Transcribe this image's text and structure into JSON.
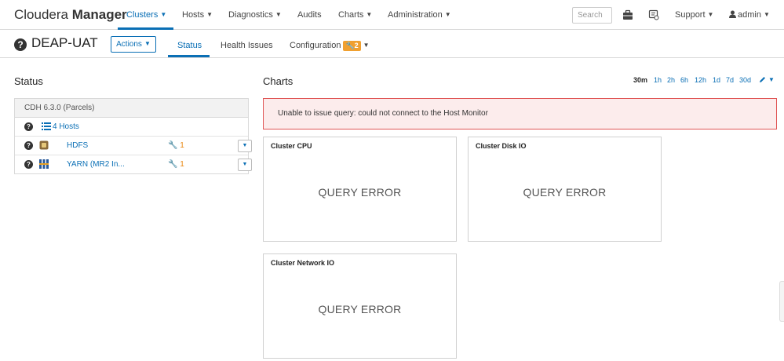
{
  "brand": {
    "prefix": "Cloudera",
    "name": "Manager"
  },
  "nav": {
    "clusters": "Clusters",
    "hosts": "Hosts",
    "diagnostics": "Diagnostics",
    "audits": "Audits",
    "charts": "Charts",
    "administration": "Administration",
    "search_placeholder": "Search",
    "support": "Support",
    "user": "admin"
  },
  "cluster": {
    "title": "DEAP-UAT",
    "actions_label": "Actions",
    "tabs": {
      "status": "Status",
      "health_issues": "Health Issues",
      "configuration": "Configuration",
      "configuration_badge": "2"
    }
  },
  "status": {
    "title": "Status",
    "cdh_version": "CDH 6.3.0 (Parcels)",
    "rows": [
      {
        "label": "4 Hosts",
        "icon": "list-icon",
        "issues": ""
      },
      {
        "label": "HDFS",
        "icon": "hdfs-icon",
        "issues": "1"
      },
      {
        "label": "YARN (MR2 In...",
        "icon": "yarn-icon",
        "issues": "1"
      }
    ]
  },
  "charts": {
    "title": "Charts",
    "time_ranges": [
      "30m",
      "1h",
      "2h",
      "6h",
      "12h",
      "1d",
      "7d",
      "30d"
    ],
    "selected_range": "30m",
    "alert": "Unable to issue query: could not connect to the Host Monitor",
    "cards": [
      {
        "title": "Cluster CPU",
        "message": "QUERY ERROR"
      },
      {
        "title": "Cluster Disk IO",
        "message": "QUERY ERROR"
      },
      {
        "title": "Cluster Network IO",
        "message": "QUERY ERROR"
      }
    ]
  },
  "colors": {
    "link": "#0a6fb5",
    "alert_border": "#e05555",
    "alert_bg": "#fcecec",
    "badge": "#f0a030",
    "wrench": "#e8860e"
  }
}
